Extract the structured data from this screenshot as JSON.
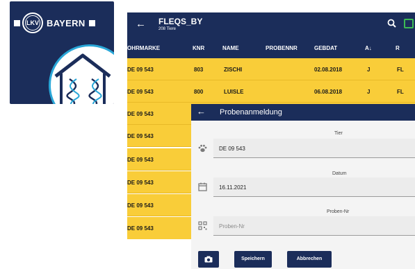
{
  "app_icon": {
    "logo_mark": "LKV",
    "logo_brand": "BAYERN",
    "house_icon": "house-dna-icon"
  },
  "topbar": {
    "back_icon": "←",
    "title": "FLEQS_BY",
    "subtitle": "208 Tiere",
    "search_icon": "search-icon",
    "export_icon": "gallery-icon"
  },
  "table": {
    "headers": {
      "ohrmarke": "OHRMARKE",
      "knr": "KNR",
      "name": "NAME",
      "probennr": "PROBENNR",
      "gebdat": "GEBDAT",
      "a": "A↓",
      "r": "R"
    },
    "rows": [
      {
        "ohrmarke": "DE 09 543",
        "knr": "803",
        "name": "ZISCHI",
        "gebdat": "02.08.2018",
        "a": "J",
        "r": "FL"
      },
      {
        "ohrmarke": "DE 09 543",
        "knr": "800",
        "name": "LUISLE",
        "gebdat": "06.08.2018",
        "a": "J",
        "r": "FL"
      },
      {
        "ohrmarke": "DE 09 543"
      },
      {
        "ohrmarke": "DE 09 543"
      },
      {
        "ohrmarke": "DE 09 543"
      },
      {
        "ohrmarke": "DE 09 543"
      },
      {
        "ohrmarke": "DE 09 543"
      },
      {
        "ohrmarke": "DE 09 543"
      }
    ]
  },
  "dialog": {
    "back_icon": "←",
    "title": "Probenanmeldung",
    "tier_label": "Tier",
    "tier_value": "DE 09 543",
    "datum_label": "Datum",
    "datum_value": "16.11.2021",
    "proben_label": "Proben-Nr",
    "proben_placeholder": "Proben-Nr",
    "save_label": "Speichern",
    "cancel_label": "Abbrechen"
  },
  "colors": {
    "navy": "#1b2d5a",
    "yellow": "#f9cd39",
    "accent_blue": "#2aa7d8",
    "green": "#3cba54"
  }
}
